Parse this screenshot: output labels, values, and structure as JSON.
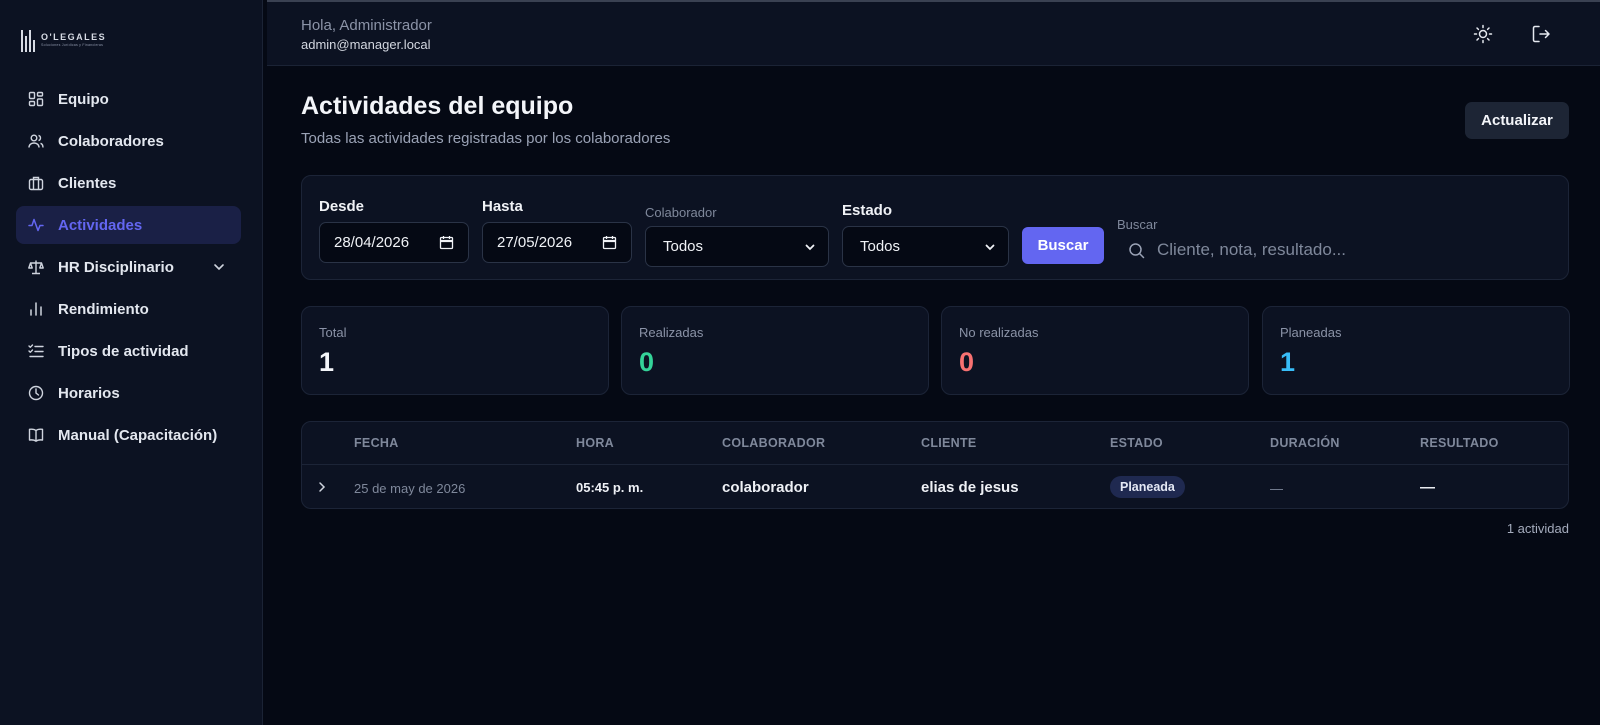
{
  "brand": {
    "name": "O'LEGALES",
    "tagline": "Soluciones Jurídicas y Financieras"
  },
  "sidebar": {
    "items": [
      {
        "label": "Equipo",
        "icon": "dashboard-icon",
        "active": false
      },
      {
        "label": "Colaboradores",
        "icon": "users-icon",
        "active": false
      },
      {
        "label": "Clientes",
        "icon": "briefcase-icon",
        "active": false
      },
      {
        "label": "Actividades",
        "icon": "activity-icon",
        "active": true
      },
      {
        "label": "HR Disciplinario",
        "icon": "scale-icon",
        "active": false,
        "expandable": true
      },
      {
        "label": "Rendimiento",
        "icon": "bar-chart-icon",
        "active": false
      },
      {
        "label": "Tipos de actividad",
        "icon": "list-checks-icon",
        "active": false
      },
      {
        "label": "Horarios",
        "icon": "clock-icon",
        "active": false
      },
      {
        "label": "Manual (Capacitación)",
        "icon": "book-icon",
        "active": false
      }
    ]
  },
  "header": {
    "greeting": "Hola, Administrador",
    "email": "admin@manager.local",
    "theme_icon": "sun-icon",
    "logout_icon": "logout-icon"
  },
  "page": {
    "title": "Actividades del equipo",
    "subtitle": "Todas las actividades registradas por los colaboradores",
    "refresh_label": "Actualizar"
  },
  "filters": {
    "from_label": "Desde",
    "from_value": "28/04/2026",
    "to_label": "Hasta",
    "to_value": "27/05/2026",
    "collaborator_label": "Colaborador",
    "collaborator_value": "Todos",
    "status_label": "Estado",
    "status_value": "Todos",
    "search_button": "Buscar",
    "search_label": "Buscar",
    "search_placeholder": "Cliente, nota, resultado..."
  },
  "stats": [
    {
      "label": "Total",
      "value": "1",
      "color": "#f3f5f9"
    },
    {
      "label": "Realizadas",
      "value": "0",
      "color": "#34d399"
    },
    {
      "label": "No realizadas",
      "value": "0",
      "color": "#f87171"
    },
    {
      "label": "Planeadas",
      "value": "1",
      "color": "#38bdf8"
    }
  ],
  "table": {
    "columns": [
      "FECHA",
      "HORA",
      "COLABORADOR",
      "CLIENTE",
      "ESTADO",
      "DURACIÓN",
      "RESULTADO"
    ],
    "rows": [
      {
        "fecha": "25 de may de 2026",
        "hora": "05:45 p. m.",
        "colaborador": "colaborador",
        "cliente": "elias de jesus",
        "estado": "Planeada",
        "duracion": "—",
        "resultado": "—"
      }
    ]
  },
  "footer": {
    "count": "1 actividad"
  },
  "colors": {
    "accent": "#6366f1",
    "background": "#050914",
    "panel": "#0c1222"
  }
}
